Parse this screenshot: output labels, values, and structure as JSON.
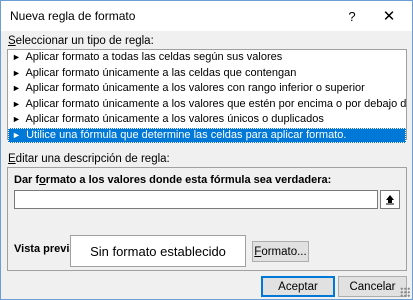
{
  "window": {
    "title": "Nueva regla de formato",
    "help_glyph": "?",
    "close_glyph": "✕"
  },
  "rule_type": {
    "heading_hotkey": "S",
    "heading_rest": "eleccionar un tipo de regla:",
    "selected_index": 5,
    "items": [
      "Aplicar formato a todas las celdas según sus valores",
      "Aplicar formato únicamente a las celdas que contengan",
      "Aplicar formato únicamente a los valores con rango inferior o superior",
      "Aplicar formato únicamente a los valores que estén por encima o por debajo del promedio",
      "Aplicar formato únicamente a los valores únicos o duplicados",
      "Utilice una fórmula que determine las celdas para aplicar formato."
    ],
    "item_arrow": "►"
  },
  "description": {
    "heading_hotkey": "E",
    "heading_rest": "ditar una descripción de regla:",
    "formula_label_pre": "Dar f",
    "formula_label_hotkey": "o",
    "formula_label_post": "rmato a los valores donde esta fórmula sea verdadera:",
    "formula_value": "",
    "preview_label": "Vista previa:",
    "preview_text": "Sin formato establecido",
    "format_button_hotkey": "F",
    "format_button_rest": "ormato..."
  },
  "footer": {
    "ok_label": "Aceptar",
    "cancel_label": "Cancelar"
  }
}
